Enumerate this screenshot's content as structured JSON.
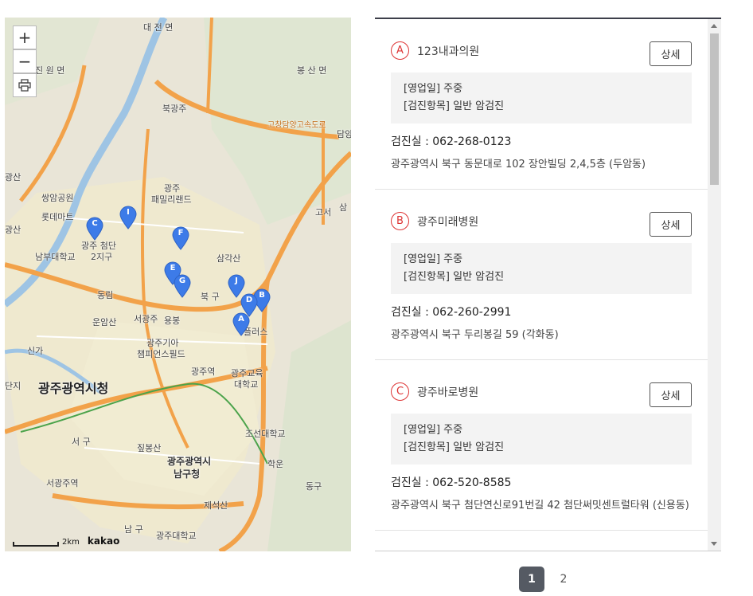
{
  "map": {
    "zoom_in": "+",
    "zoom_out": "−",
    "print_icon": "printer-icon",
    "scale_label": "2km",
    "brand": "kakao",
    "labels": {
      "city_hall": "광주광역시청",
      "namgu_office_1": "광주광역시",
      "namgu_office_2": "남구청",
      "daejeon": "대 전 면",
      "jinwon": "진 원 면",
      "bongsan": "봉 산 면",
      "bukgwangju": "북광주",
      "gochang": "고창담양고속도로",
      "damyang": "담양",
      "gwangsan_ic": "광산",
      "ssangam": "쌍암공원",
      "lotte": "롯데마트",
      "cheomdan": "광주 첨단",
      "cheomdan2": "2지구",
      "family_1": "광주",
      "family_2": "패밀리랜드",
      "samgaksan": "삼각산",
      "nambu": "남부대학교",
      "dongrim": "동림",
      "unamsan": "운암산",
      "seogwangju": "서광주",
      "yongbong": "용봉",
      "bukgu": "북 구",
      "plus": "플러스",
      "kia_1": "광주기아",
      "kia_2": "챔피언스필드",
      "gwangju_station": "광주역",
      "edu_1": "광주교육",
      "edu_2": "대학교",
      "singa": "신가",
      "seogu": "서 구",
      "jinbong": "짚봉산",
      "chosun": "조선대학교",
      "hagun": "학운",
      "donggu": "동구",
      "seogwangju_station": "서광주역",
      "jeseoksan": "제석산",
      "namgu": "남 구",
      "gwangju_univ": "광주대학교",
      "goseo": "고서",
      "samgok": "삼",
      "ok": "사",
      "dan": "단지",
      "gwangsan": "광산"
    },
    "markers": [
      "A",
      "B",
      "C",
      "D",
      "E",
      "F",
      "G",
      "I",
      "J"
    ]
  },
  "list": {
    "items": [
      {
        "letter": "A",
        "name": "123내과의원",
        "detail": "상세",
        "line1": "[영업일] 주중",
        "line2": "[검진항목] 일반 암검진",
        "phone": "검진실 :  062-268-0123",
        "address": "광주광역시 북구 동문대로 102 장안빌딩 2,4,5층 (두암동)"
      },
      {
        "letter": "B",
        "name": "광주미래병원",
        "detail": "상세",
        "line1": "[영업일] 주중",
        "line2": "[검진항목] 일반 암검진",
        "phone": "검진실 :  062-260-2991",
        "address": "광주광역시 북구 두리봉길 59 (각화동)"
      },
      {
        "letter": "C",
        "name": "광주바로병원",
        "detail": "상세",
        "line1": "[영업일] 주중",
        "line2": "[검진항목] 일반 암검진",
        "phone": "검진실 :  062-520-8585",
        "address": "광주광역시 북구 첨단연신로91번길 42 첨단써밋센트럴타워 (신용동)"
      }
    ]
  },
  "pager": {
    "pages": [
      "1",
      "2"
    ],
    "active": "1"
  },
  "colors": {
    "pin": "#3d7be8",
    "badge": "#d33333",
    "road": "#f2a24a"
  }
}
